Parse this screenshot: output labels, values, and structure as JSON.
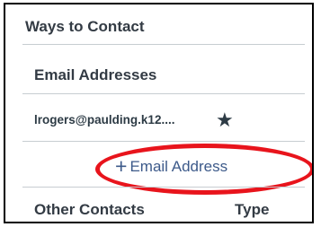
{
  "panel": {
    "title": "Ways to Contact"
  },
  "email_section": {
    "heading": "Email Addresses",
    "addresses": [
      {
        "value": "lrogers@paulding.k12....",
        "icon": "star-icon"
      }
    ],
    "add_label": "Email Address",
    "add_icon": "plus-icon"
  },
  "other_contacts": {
    "heading": "Other Contacts",
    "type_column": "Type"
  },
  "annotation": {
    "highlight_color": "#e8141c"
  }
}
